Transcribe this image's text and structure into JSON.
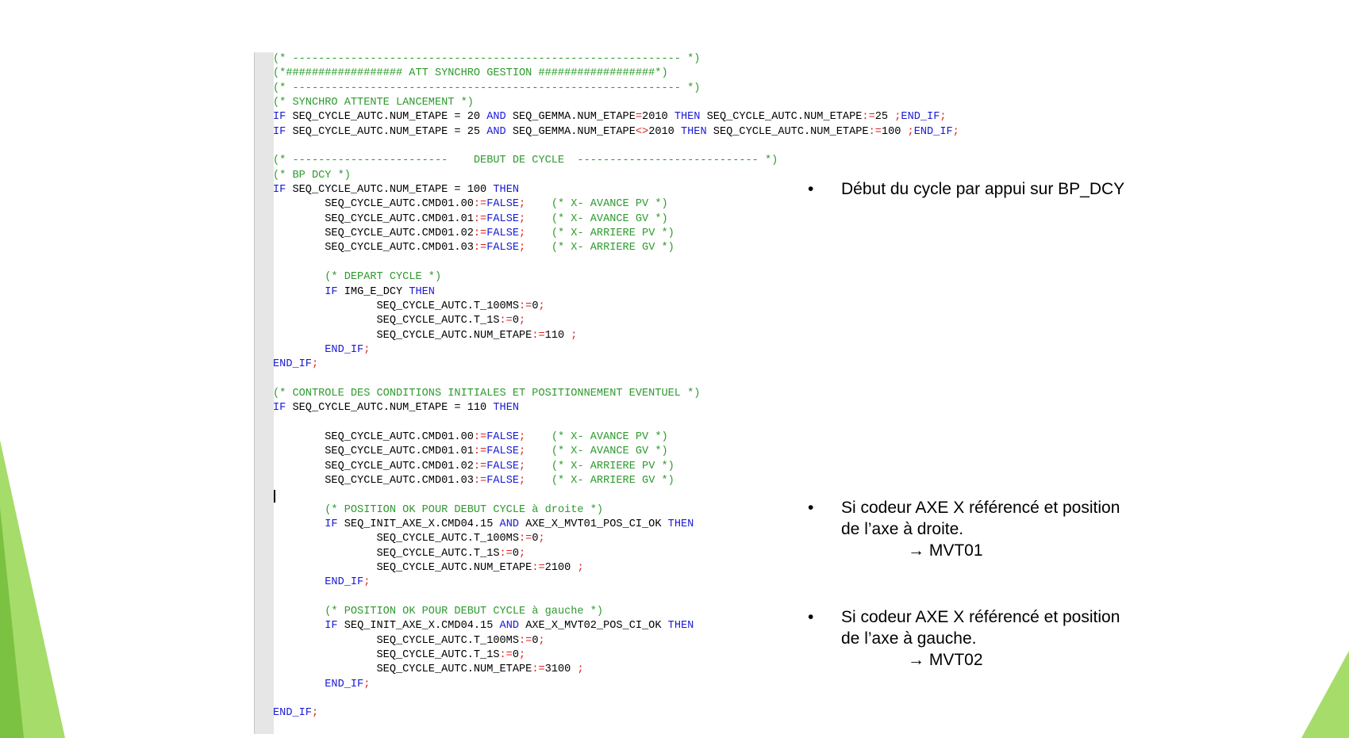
{
  "code_lines": [
    [
      [
        "c",
        "(* ------------------------------------------------------------ *)"
      ]
    ],
    [
      [
        "c",
        "(*################## ATT SYNCHRO GESTION ##################*)"
      ]
    ],
    [
      [
        "c",
        "(* ------------------------------------------------------------ *)"
      ]
    ],
    [
      [
        "c",
        "(* SYNCHRO ATTENTE LANCEMENT *)"
      ]
    ],
    [
      [
        "k",
        "IF"
      ],
      [
        "t",
        " SEQ_CYCLE_AUTC.NUM_ETAPE = 20 "
      ],
      [
        "k",
        "AND"
      ],
      [
        "t",
        " SEQ_GEMMA.NUM_ETAPE"
      ],
      [
        "o",
        "="
      ],
      [
        "t",
        "2010 "
      ],
      [
        "k",
        "THEN"
      ],
      [
        "t",
        " SEQ_CYCLE_AUTC.NUM_ETAPE"
      ],
      [
        "o",
        ":="
      ],
      [
        "t",
        "25 "
      ],
      [
        "o",
        ";"
      ],
      [
        "k",
        "END_IF"
      ],
      [
        "o",
        ";"
      ]
    ],
    [
      [
        "k",
        "IF"
      ],
      [
        "t",
        " SEQ_CYCLE_AUTC.NUM_ETAPE = 25 "
      ],
      [
        "k",
        "AND"
      ],
      [
        "t",
        " SEQ_GEMMA.NUM_ETAPE"
      ],
      [
        "o",
        "<>"
      ],
      [
        "t",
        "2010 "
      ],
      [
        "k",
        "THEN"
      ],
      [
        "t",
        " SEQ_CYCLE_AUTC.NUM_ETAPE"
      ],
      [
        "o",
        ":="
      ],
      [
        "t",
        "100 "
      ],
      [
        "o",
        ";"
      ],
      [
        "k",
        "END_IF"
      ],
      [
        "o",
        ";"
      ]
    ],
    [
      [
        "t",
        ""
      ]
    ],
    [
      [
        "c",
        "(* ------------------------    DEBUT DE CYCLE  ---------------------------- *)"
      ]
    ],
    [
      [
        "c",
        "(* BP DCY *)"
      ]
    ],
    [
      [
        "k",
        "IF"
      ],
      [
        "t",
        " SEQ_CYCLE_AUTC.NUM_ETAPE = 100 "
      ],
      [
        "k",
        "THEN"
      ]
    ],
    [
      [
        "t",
        "        SEQ_CYCLE_AUTC.CMD01.00"
      ],
      [
        "o",
        ":="
      ],
      [
        "k",
        "FALSE"
      ],
      [
        "o",
        ";"
      ],
      [
        "t",
        "    "
      ],
      [
        "c",
        "(* X- AVANCE PV *)"
      ]
    ],
    [
      [
        "t",
        "        SEQ_CYCLE_AUTC.CMD01.01"
      ],
      [
        "o",
        ":="
      ],
      [
        "k",
        "FALSE"
      ],
      [
        "o",
        ";"
      ],
      [
        "t",
        "    "
      ],
      [
        "c",
        "(* X- AVANCE GV *)"
      ]
    ],
    [
      [
        "t",
        "        SEQ_CYCLE_AUTC.CMD01.02"
      ],
      [
        "o",
        ":="
      ],
      [
        "k",
        "FALSE"
      ],
      [
        "o",
        ";"
      ],
      [
        "t",
        "    "
      ],
      [
        "c",
        "(* X- ARRIERE PV *)"
      ]
    ],
    [
      [
        "t",
        "        SEQ_CYCLE_AUTC.CMD01.03"
      ],
      [
        "o",
        ":="
      ],
      [
        "k",
        "FALSE"
      ],
      [
        "o",
        ";"
      ],
      [
        "t",
        "    "
      ],
      [
        "c",
        "(* X- ARRIERE GV *)"
      ]
    ],
    [
      [
        "t",
        ""
      ]
    ],
    [
      [
        "t",
        "        "
      ],
      [
        "c",
        "(* DEPART CYCLE *)"
      ]
    ],
    [
      [
        "t",
        "        "
      ],
      [
        "k",
        "IF"
      ],
      [
        "t",
        " IMG_E_DCY "
      ],
      [
        "k",
        "THEN"
      ]
    ],
    [
      [
        "t",
        "                SEQ_CYCLE_AUTC.T_100MS"
      ],
      [
        "o",
        ":="
      ],
      [
        "t",
        "0"
      ],
      [
        "o",
        ";"
      ]
    ],
    [
      [
        "t",
        "                SEQ_CYCLE_AUTC.T_1S"
      ],
      [
        "o",
        ":="
      ],
      [
        "t",
        "0"
      ],
      [
        "o",
        ";"
      ]
    ],
    [
      [
        "t",
        "                SEQ_CYCLE_AUTC.NUM_ETAPE"
      ],
      [
        "o",
        ":="
      ],
      [
        "t",
        "110 "
      ],
      [
        "o",
        ";"
      ]
    ],
    [
      [
        "t",
        "        "
      ],
      [
        "k",
        "END_IF"
      ],
      [
        "o",
        ";"
      ]
    ],
    [
      [
        "k",
        "END_IF"
      ],
      [
        "o",
        ";"
      ]
    ],
    [
      [
        "t",
        ""
      ]
    ],
    [
      [
        "c",
        "(* CONTROLE DES CONDITIONS INITIALES ET POSITIONNEMENT EVENTUEL *)"
      ]
    ],
    [
      [
        "k",
        "IF"
      ],
      [
        "t",
        " SEQ_CYCLE_AUTC.NUM_ETAPE = 110 "
      ],
      [
        "k",
        "THEN"
      ]
    ],
    [
      [
        "t",
        ""
      ]
    ],
    [
      [
        "t",
        "        SEQ_CYCLE_AUTC.CMD01.00"
      ],
      [
        "o",
        ":="
      ],
      [
        "k",
        "FALSE"
      ],
      [
        "o",
        ";"
      ],
      [
        "t",
        "    "
      ],
      [
        "c",
        "(* X- AVANCE PV *)"
      ]
    ],
    [
      [
        "t",
        "        SEQ_CYCLE_AUTC.CMD01.01"
      ],
      [
        "o",
        ":="
      ],
      [
        "k",
        "FALSE"
      ],
      [
        "o",
        ";"
      ],
      [
        "t",
        "    "
      ],
      [
        "c",
        "(* X- AVANCE GV *)"
      ]
    ],
    [
      [
        "t",
        "        SEQ_CYCLE_AUTC.CMD01.02"
      ],
      [
        "o",
        ":="
      ],
      [
        "k",
        "FALSE"
      ],
      [
        "o",
        ";"
      ],
      [
        "t",
        "    "
      ],
      [
        "c",
        "(* X- ARRIERE PV *)"
      ]
    ],
    [
      [
        "t",
        "        SEQ_CYCLE_AUTC.CMD01.03"
      ],
      [
        "o",
        ":="
      ],
      [
        "k",
        "FALSE"
      ],
      [
        "o",
        ";"
      ],
      [
        "t",
        "    "
      ],
      [
        "c",
        "(* X- ARRIERE GV *)"
      ]
    ],
    [
      [
        "t",
        ""
      ]
    ],
    [
      [
        "t",
        "        "
      ],
      [
        "c",
        "(* POSITION OK POUR DEBUT CYCLE à droite *)"
      ]
    ],
    [
      [
        "t",
        "        "
      ],
      [
        "k",
        "IF"
      ],
      [
        "t",
        " SEQ_INIT_AXE_X.CMD04.15 "
      ],
      [
        "k",
        "AND"
      ],
      [
        "t",
        " AXE_X_MVT01_POS_CI_OK "
      ],
      [
        "k",
        "THEN"
      ]
    ],
    [
      [
        "t",
        "                SEQ_CYCLE_AUTC.T_100MS"
      ],
      [
        "o",
        ":="
      ],
      [
        "t",
        "0"
      ],
      [
        "o",
        ";"
      ]
    ],
    [
      [
        "t",
        "                SEQ_CYCLE_AUTC.T_1S"
      ],
      [
        "o",
        ":="
      ],
      [
        "t",
        "0"
      ],
      [
        "o",
        ";"
      ]
    ],
    [
      [
        "t",
        "                SEQ_CYCLE_AUTC.NUM_ETAPE"
      ],
      [
        "o",
        ":="
      ],
      [
        "t",
        "2100 "
      ],
      [
        "o",
        ";"
      ]
    ],
    [
      [
        "t",
        "        "
      ],
      [
        "k",
        "END_IF"
      ],
      [
        "o",
        ";"
      ]
    ],
    [
      [
        "t",
        ""
      ]
    ],
    [
      [
        "t",
        "        "
      ],
      [
        "c",
        "(* POSITION OK POUR DEBUT CYCLE à gauche *)"
      ]
    ],
    [
      [
        "t",
        "        "
      ],
      [
        "k",
        "IF"
      ],
      [
        "t",
        " SEQ_INIT_AXE_X.CMD04.15 "
      ],
      [
        "k",
        "AND"
      ],
      [
        "t",
        " AXE_X_MVT02_POS_CI_OK "
      ],
      [
        "k",
        "THEN"
      ]
    ],
    [
      [
        "t",
        "                SEQ_CYCLE_AUTC.T_100MS"
      ],
      [
        "o",
        ":="
      ],
      [
        "t",
        "0"
      ],
      [
        "o",
        ";"
      ]
    ],
    [
      [
        "t",
        "                SEQ_CYCLE_AUTC.T_1S"
      ],
      [
        "o",
        ":="
      ],
      [
        "t",
        "0"
      ],
      [
        "o",
        ";"
      ]
    ],
    [
      [
        "t",
        "                SEQ_CYCLE_AUTC.NUM_ETAPE"
      ],
      [
        "o",
        ":="
      ],
      [
        "t",
        "3100 "
      ],
      [
        "o",
        ";"
      ]
    ],
    [
      [
        "t",
        "        "
      ],
      [
        "k",
        "END_IF"
      ],
      [
        "o",
        ";"
      ]
    ],
    [
      [
        "t",
        ""
      ]
    ],
    [
      [
        "k",
        "END_IF"
      ],
      [
        "o",
        ";"
      ]
    ]
  ],
  "notes": [
    {
      "bullet": "•",
      "lines": [
        "Début du cycle par appui sur BP_DCY"
      ]
    },
    {
      "bullet": "•",
      "lines": [
        "Si codeur AXE X référencé et position",
        "de l’axe à droite."
      ],
      "arrow": "→ MVT01"
    },
    {
      "bullet": "•",
      "lines": [
        "Si codeur AXE X référencé et position",
        "de l’axe à gauche."
      ],
      "arrow": "→ MVT02"
    }
  ],
  "colors": {
    "comment": "#2e9a2e",
    "keyword": "#1a1ad6",
    "operator": "#e01c1c",
    "decor_light": "#a6dc6a",
    "decor_dark": "#7cc242"
  }
}
